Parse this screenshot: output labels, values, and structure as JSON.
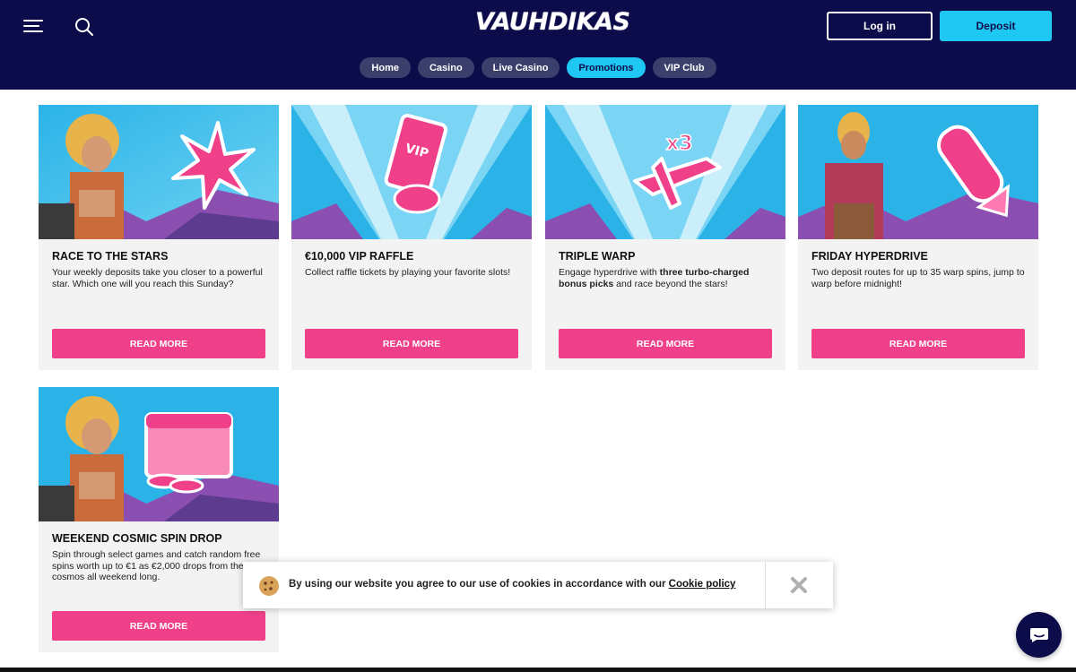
{
  "header": {
    "logo_text": "VAUHDIKAS",
    "login_label": "Log in",
    "deposit_label": "Deposit",
    "menu_icon": "hamburger-menu-icon",
    "search_icon": "search-icon"
  },
  "nav": {
    "tabs": [
      {
        "label": "Home",
        "active": false
      },
      {
        "label": "Casino",
        "active": false
      },
      {
        "label": "Live Casino",
        "active": false
      },
      {
        "label": "Promotions",
        "active": true
      },
      {
        "label": "VIP Club",
        "active": false
      }
    ]
  },
  "promotions": [
    {
      "title": "RACE TO THE STARS",
      "description": "Your weekly deposits take you closer to a powerful star. Which one will you reach this Sunday?",
      "button": "READ MORE"
    },
    {
      "title": "€10,000 VIP RAFFLE",
      "description": "Collect raffle tickets by playing your favorite slots!",
      "button": "READ MORE"
    },
    {
      "title": "TRIPLE WARP",
      "description_pre": "Engage hyperdrive with ",
      "description_bold": "three turbo-charged bonus picks",
      "description_post": " and race beyond the stars!",
      "button": "READ MORE"
    },
    {
      "title": "FRIDAY HYPERDRIVE",
      "description": "Two deposit routes for up to 35 warp spins, jump to warp before midnight!",
      "button": "READ MORE"
    },
    {
      "title": "WEEKEND COSMIC SPIN DROP",
      "description": "Spin through select games and catch random free spins worth up to €1 as €2,000 drops from the cosmos all weekend long.",
      "button": "READ MORE"
    }
  ],
  "cookie": {
    "text": "By using our website you agree to our use of cookies in accordance with our ",
    "link": "Cookie policy"
  },
  "colors": {
    "header_bg": "#0d0c4b",
    "accent_cyan": "#1ec8f2",
    "button_pink": "#f0408a"
  }
}
